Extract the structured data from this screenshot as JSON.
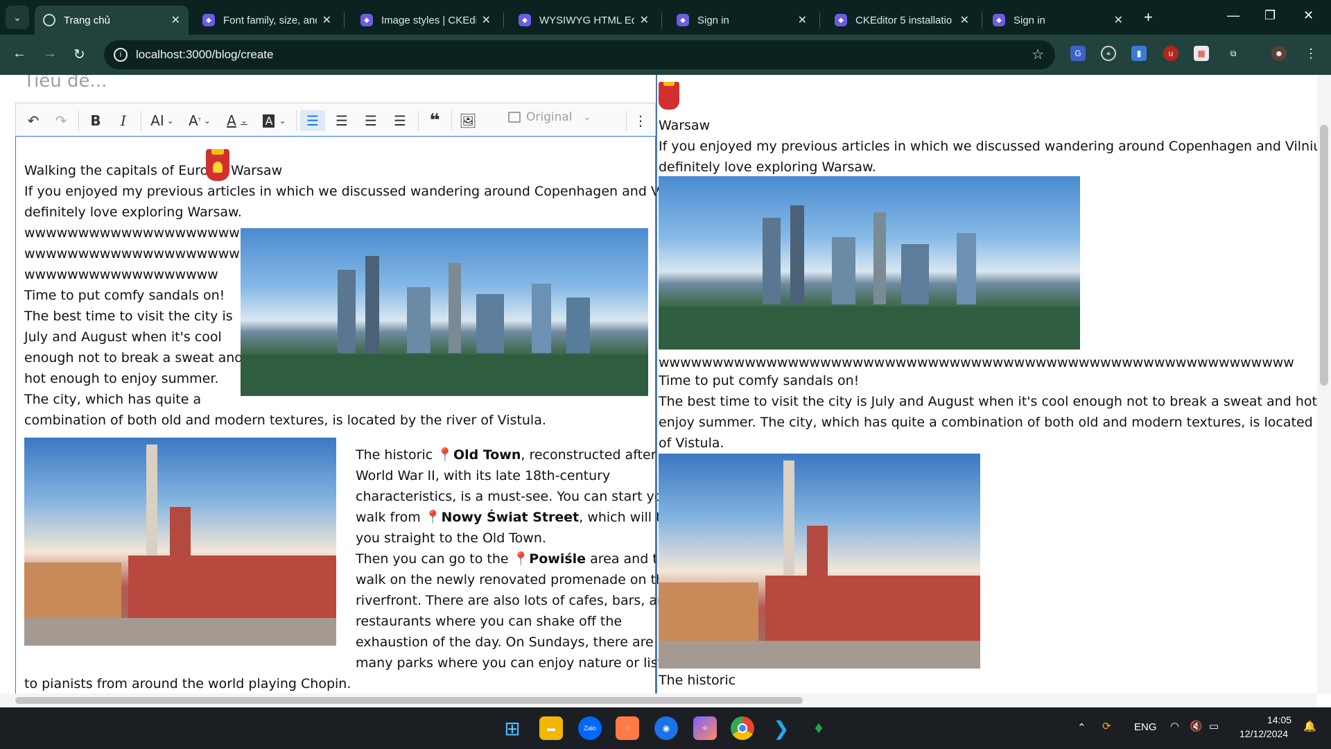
{
  "browser": {
    "tabs": [
      {
        "label": "Trang chủ"
      },
      {
        "label": "Font family, size, and"
      },
      {
        "label": "Image styles | CKEdito"
      },
      {
        "label": "WYSIWYG HTML Edit"
      },
      {
        "label": "Sign in"
      },
      {
        "label": "CKEditor 5 installatio"
      },
      {
        "label": "Sign in"
      }
    ],
    "new_tab": "+",
    "url": "localhost:3000/blog/create"
  },
  "editor": {
    "title_placeholder": "Tiêu đề...",
    "toolbar": {
      "image_size_label": "Original",
      "icons": [
        "undo-icon",
        "redo-icon",
        "bold-icon",
        "italic-icon",
        "font-size-icon",
        "font-family-icon",
        "font-color-icon",
        "font-background-icon",
        "align-left-icon",
        "align-center-icon",
        "align-right-icon",
        "align-justify-icon",
        "blockquote-icon",
        "insert-image-icon",
        "image-resize-icon",
        "more-options-icon"
      ],
      "active_accent": "#1a73e8"
    },
    "content": {
      "heading_prefix": "Walking the capitals of Europe:",
      "heading_suffix": "Warsaw",
      "intro_line1": "If you enjoyed my previous articles in which we discussed wandering around Copenhagen and Vilnius, you'll",
      "intro_line2": "definitely love exploring Warsaw.",
      "w_line1": "wwwwwwwwwwwwwwwwwwww",
      "w_line2": "wwwwwwwwwwwwwwwwwwww",
      "w_line3": "wwwwwwwwwwwwwwwwww",
      "p1_line1": "Time to put comfy sandals on!",
      "p1_line2": "The best time to visit the city is",
      "p1_line3": "July and August when it's cool",
      "p1_line4": "enough not to break a sweat and",
      "p1_line5": "hot enough to enjoy summer.",
      "p1_line6": "The city, which has quite a",
      "p1_line7": "combination of both old and modern textures, is located by the river of Vistula.",
      "p2_line1_pre": "The historic",
      "p2_line1_bold": "Old Town",
      "p2_line1_post": ", reconstructed after",
      "p2_line2": "World War II, with its late 18th-century",
      "p2_line3": "characteristics, is a must-see. You can start your",
      "p2_line4_pre": "walk from",
      "p2_line4_bold": "Nowy Świat Street",
      "p2_line4_post": ", which will take",
      "p2_line5": "you straight to the Old Town.",
      "p3_line1_pre": "Then you can go to the",
      "p3_line1_bold": "Powiśle",
      "p3_line1_post": "area and take a",
      "p3_line2": "walk on the newly renovated promenade on the",
      "p3_line3": "riverfront. There are also lots of cafes, bars, and",
      "p3_line4": "restaurants where you can shake off the",
      "p3_line5": "exhaustion of the day. On Sundays, there are",
      "p3_line6": "many parks where you can enjoy nature or listen",
      "p3_line7": "to pianists from around the world playing Chopin."
    }
  },
  "preview": {
    "warsaw": "Warsaw",
    "intro_line1": "If you enjoyed my previous articles in which we discussed wandering around Copenhagen and Vilnius, you'll",
    "intro_line2": "definitely love exploring Warsaw.",
    "w_line": "wwwwwwwwwwwwwwwwwwwwwwwwwwwwwwwwwwwwwwwwwwwwwwwwwwwwwwwwwww",
    "p1_line1": "Time to put comfy sandals on!",
    "p1_line2": "The best time to visit the city is July and August when it's cool enough not to break a sweat and hot enough to",
    "p1_line3": "enjoy summer. The city, which has quite a combination of both old and modern textures, is located by the river",
    "p1_line4": "of Vistula.",
    "historic": "The historic"
  },
  "taskbar": {
    "lang": "ENG",
    "time": "14:05",
    "date": "12/12/2024",
    "apps": [
      "windows-start-icon",
      "file-explorer-icon",
      "zalo-icon",
      "app-icon",
      "chrome-like-icon",
      "copilot-icon",
      "chrome-icon",
      "vscode-icon",
      "mongodb-icon"
    ],
    "zalo_label": "Zalo"
  }
}
